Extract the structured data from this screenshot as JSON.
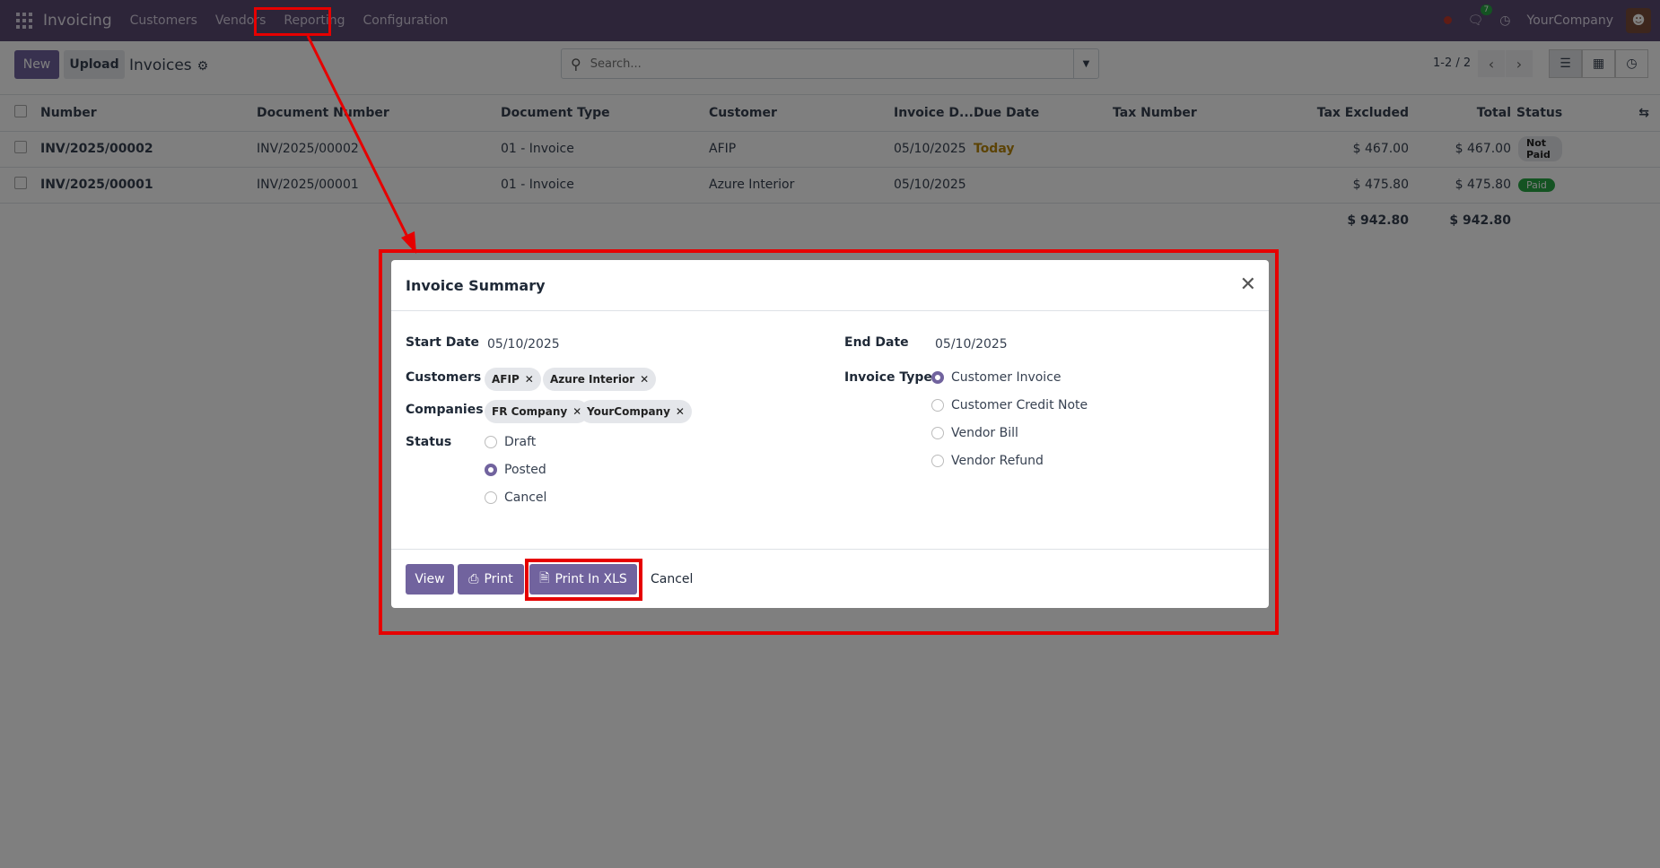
{
  "navbar": {
    "app_name": "Invoicing",
    "menu": [
      "Customers",
      "Vendors",
      "Reporting",
      "Configuration"
    ],
    "chat_badge": "7",
    "company": "YourCompany"
  },
  "control_panel": {
    "new_label": "New",
    "upload_label": "Upload",
    "breadcrumb": "Invoices",
    "search_placeholder": "Search...",
    "pager": "1-2 / 2"
  },
  "table": {
    "headers": [
      "Number",
      "Document Number",
      "Document Type",
      "Customer",
      "Invoice D...",
      "Due Date",
      "Tax Number",
      "Tax Excluded",
      "Total",
      "Status"
    ],
    "rows": [
      {
        "number": "INV/2025/00002",
        "doc_number": "INV/2025/00002",
        "doc_type": "01 - Invoice",
        "customer": "AFIP",
        "invoice_date": "05/10/2025",
        "due_date": "Today",
        "tax_number": "",
        "tax_excluded": "$ 467.00",
        "total": "$ 467.00",
        "status": "Not Paid"
      },
      {
        "number": "INV/2025/00001",
        "doc_number": "INV/2025/00001",
        "doc_type": "01 - Invoice",
        "customer": "Azure Interior",
        "invoice_date": "05/10/2025",
        "due_date": "",
        "tax_number": "",
        "tax_excluded": "$ 475.80",
        "total": "$ 475.80",
        "status": "Paid"
      }
    ],
    "totals": {
      "tax_excluded": "$ 942.80",
      "total": "$ 942.80"
    }
  },
  "modal": {
    "title": "Invoice Summary",
    "start_date_label": "Start Date",
    "start_date": "05/10/2025",
    "end_date_label": "End Date",
    "end_date": "05/10/2025",
    "customers_label": "Customers",
    "customers": [
      "AFIP",
      "Azure Interior"
    ],
    "companies_label": "Companies",
    "companies": [
      "FR Company",
      "YourCompany"
    ],
    "status_label": "Status",
    "status_options": [
      "Draft",
      "Posted",
      "Cancel"
    ],
    "status_selected": "Posted",
    "invoice_type_label": "Invoice Type",
    "invoice_type_options": [
      "Customer Invoice",
      "Customer Credit Note",
      "Vendor Bill",
      "Vendor Refund"
    ],
    "invoice_type_selected": "Customer Invoice",
    "buttons": {
      "view": "View",
      "print": "Print",
      "print_xls": "Print In XLS",
      "cancel": "Cancel"
    }
  },
  "colors": {
    "navbar": "#5a4a73",
    "primary": "#71639e",
    "highlight": "#e60000"
  }
}
